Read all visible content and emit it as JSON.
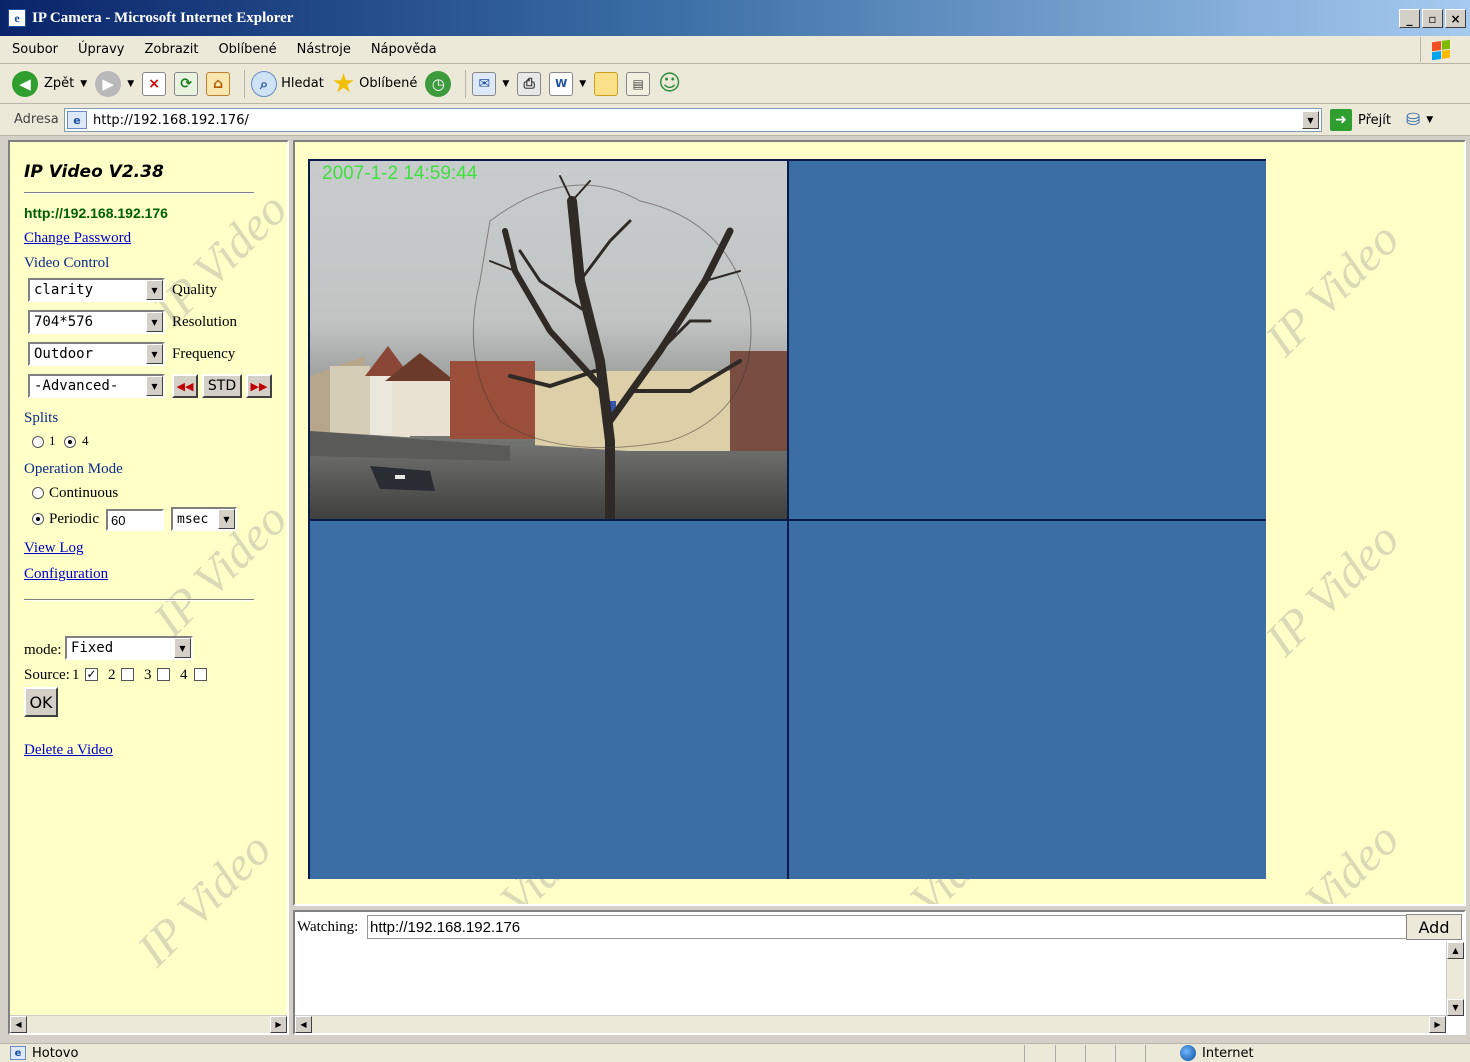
{
  "window": {
    "title": "IP Camera - Microsoft Internet Explorer",
    "min": "_",
    "max": "▫",
    "close": "×"
  },
  "menu": [
    "Soubor",
    "Úpravy",
    "Zobrazit",
    "Oblíbené",
    "Nástroje",
    "Nápověda"
  ],
  "toolbar": {
    "back": "Zpět",
    "search": "Hledat",
    "favorites": "Oblíbené"
  },
  "address": {
    "label": "Adresa",
    "url": "http://192.168.192.176/",
    "go": "Přejít"
  },
  "left": {
    "version": "IP Video V2.38",
    "url": "http://192.168.192.176",
    "change_password": "Change Password",
    "video_control": "Video Control",
    "quality_value": "clarity",
    "quality_label": "Quality",
    "resolution_value": "704*576",
    "resolution_label": "Resolution",
    "frequency_value": "Outdoor",
    "frequency_label": "Frequency",
    "advanced_value": "-Advanced-",
    "std": "STD",
    "splits": "Splits",
    "split_1": "1",
    "split_4": "4",
    "splits_selected": 4,
    "operation_mode": "Operation Mode",
    "continuous": "Continuous",
    "periodic": "Periodic",
    "periodic_value": "60",
    "unit_value": "msec",
    "view_log": "View Log",
    "configuration": "Configuration",
    "mode_label": "mode:",
    "mode_value": "Fixed",
    "source_label": "Source:",
    "sources": [
      {
        "n": "1",
        "checked": true
      },
      {
        "n": "2",
        "checked": false
      },
      {
        "n": "3",
        "checked": false
      },
      {
        "n": "4",
        "checked": false
      }
    ],
    "ok": "OK",
    "delete_video": "Delete a Video"
  },
  "video": {
    "timestamp": "2007-1-2  14:59:44",
    "cell_color": "#3a6ea5"
  },
  "watermark": "IP Video",
  "bottom": {
    "watching_label": "Watching:",
    "watching_url": "http://192.168.192.176",
    "add": "Add"
  },
  "status": {
    "text": "Hotovo",
    "zone": "Internet"
  }
}
